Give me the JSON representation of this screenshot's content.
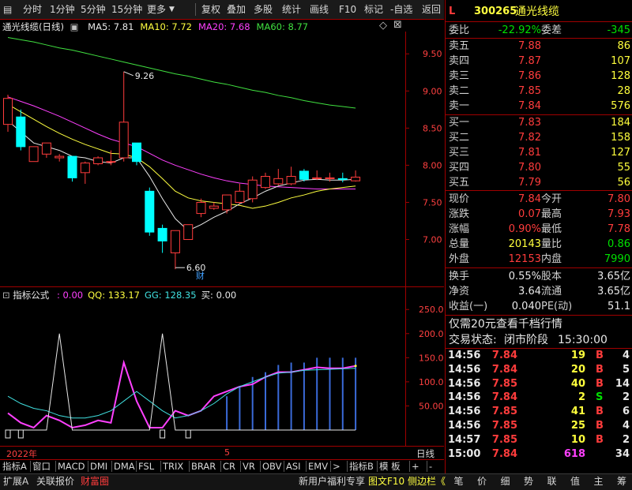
{
  "toolbar": {
    "left": [
      "分时",
      "1分钟",
      "5分钟",
      "15分钟",
      "更多"
    ],
    "right": [
      "复权",
      "叠加",
      "多股",
      "统计",
      "画线",
      "F10",
      "标记",
      "-自选",
      "返回"
    ]
  },
  "stock": {
    "flag": "L",
    "code": "300265",
    "name": "通光线缆"
  },
  "kline": {
    "title": "通光线缆(日线)",
    "ma": [
      {
        "label": "MA5: 7.81",
        "color": "#e8e8e8"
      },
      {
        "label": "MA10: 7.72",
        "color": "#ffff40"
      },
      {
        "label": "MA20: 7.68",
        "color": "#ff40ff"
      },
      {
        "label": "MA60: 8.77",
        "color": "#40e040"
      }
    ],
    "yticks": [
      "9.50",
      "9.00",
      "8.50",
      "8.00",
      "7.50",
      "7.00"
    ],
    "high_label": "9.26",
    "low_label": "6.60",
    "fin_marker": "财"
  },
  "indicator": {
    "title": "指标公式",
    "values": [
      {
        "label": ": 0.00",
        "color": "#ff40ff"
      },
      {
        "label": "QQ: 133.17",
        "color": "#ffff40"
      },
      {
        "label": "GG: 128.35",
        "color": "#40e0e0"
      },
      {
        "label": "买: 0.00",
        "color": "#e8e8e8"
      }
    ],
    "yticks": [
      "250.0",
      "200.0",
      "150.0",
      "100.0",
      "50.00"
    ]
  },
  "timeaxis": {
    "year": "2022年",
    "month": "5",
    "period": "日线"
  },
  "tabs": [
    "指标A",
    "窗口",
    "MACD",
    "DMI",
    "DMA",
    "FSL",
    "TRIX",
    "BRAR",
    "CR",
    "VR",
    "OBV",
    "ASI",
    "EMV",
    ">",
    "指标B",
    "模 板",
    "+",
    "-"
  ],
  "footer": {
    "left": [
      "扩展A",
      "关联报价",
      "财富圈"
    ],
    "mid": [
      "新用户福利专享",
      "图文F10",
      "侧边栏《"
    ],
    "right": [
      "笔",
      "价",
      "细",
      "势",
      "联",
      "值",
      "主",
      "筹"
    ]
  },
  "quote": {
    "weibi_label": "委比",
    "weibi": "-22.92%",
    "weicha_label": "委差",
    "weicha": "-345",
    "asks": [
      {
        "label": "卖五",
        "price": "7.88",
        "vol": "86"
      },
      {
        "label": "卖四",
        "price": "7.87",
        "vol": "107"
      },
      {
        "label": "卖三",
        "price": "7.86",
        "vol": "128"
      },
      {
        "label": "卖二",
        "price": "7.85",
        "vol": "28"
      },
      {
        "label": "卖一",
        "price": "7.84",
        "vol": "576"
      }
    ],
    "bids": [
      {
        "label": "买一",
        "price": "7.83",
        "vol": "184"
      },
      {
        "label": "买二",
        "price": "7.82",
        "vol": "158"
      },
      {
        "label": "买三",
        "price": "7.81",
        "vol": "127"
      },
      {
        "label": "买四",
        "price": "7.80",
        "vol": "55"
      },
      {
        "label": "买五",
        "price": "7.79",
        "vol": "56"
      }
    ],
    "stats": [
      {
        "l1": "现价",
        "v1": "7.84",
        "c1": "red",
        "l2": "今开",
        "v2": "7.80",
        "c2": "red"
      },
      {
        "l1": "涨跌",
        "v1": "0.07",
        "c1": "red",
        "l2": "最高",
        "v2": "7.93",
        "c2": "red"
      },
      {
        "l1": "涨幅",
        "v1": "0.90%",
        "c1": "red",
        "l2": "最低",
        "v2": "7.78",
        "c2": "red"
      },
      {
        "l1": "总量",
        "v1": "20143",
        "c1": "yel",
        "l2": "量比",
        "v2": "0.86",
        "c2": "grn"
      },
      {
        "l1": "外盘",
        "v1": "12153",
        "c1": "red",
        "l2": "内盘",
        "v2": "7990",
        "c2": "grn"
      }
    ],
    "stats2": [
      {
        "l1": "换手",
        "v1": "0.55%",
        "l2": "股本",
        "v2": "3.65亿"
      },
      {
        "l1": "净资",
        "v1": "3.64",
        "l2": "流通",
        "v2": "3.65亿"
      },
      {
        "l1": "收益(一)",
        "v1": "0.040",
        "l2": "PE(动)",
        "v2": "51.1"
      }
    ],
    "promo": "仅需20元查看千档行情",
    "status_label": "交易状态:",
    "status": "闭市阶段",
    "status_time": "15:30:00",
    "ticks": [
      {
        "time": "14:56",
        "price": "7.84",
        "vol": "19",
        "bs": "B",
        "n": "4",
        "vc": "yel",
        "bc": "red"
      },
      {
        "time": "14:56",
        "price": "7.84",
        "vol": "20",
        "bs": "B",
        "n": "5",
        "vc": "yel",
        "bc": "red"
      },
      {
        "time": "14:56",
        "price": "7.85",
        "vol": "40",
        "bs": "B",
        "n": "14",
        "vc": "yel",
        "bc": "red"
      },
      {
        "time": "14:56",
        "price": "7.84",
        "vol": "2",
        "bs": "S",
        "n": "2",
        "vc": "yel",
        "bc": "grn"
      },
      {
        "time": "14:56",
        "price": "7.85",
        "vol": "41",
        "bs": "B",
        "n": "6",
        "vc": "yel",
        "bc": "red"
      },
      {
        "time": "14:56",
        "price": "7.85",
        "vol": "25",
        "bs": "B",
        "n": "4",
        "vc": "yel",
        "bc": "red"
      },
      {
        "time": "14:57",
        "price": "7.85",
        "vol": "10",
        "bs": "B",
        "n": "2",
        "vc": "yel",
        "bc": "red"
      },
      {
        "time": "15:00",
        "price": "7.84",
        "vol": "618",
        "bs": "",
        "n": "34",
        "vc": "mag",
        "bc": "red"
      }
    ]
  },
  "chart_data": [
    {
      "type": "candlestick",
      "title": "通光线缆(日线)",
      "ylim": [
        6.4,
        9.8
      ],
      "candles": [
        {
          "o": 8.55,
          "c": 8.9,
          "h": 8.95,
          "l": 8.45
        },
        {
          "o": 8.65,
          "c": 8.25,
          "h": 8.75,
          "l": 8.2
        },
        {
          "o": 8.05,
          "c": 8.25,
          "h": 8.25,
          "l": 8.05
        },
        {
          "o": 8.15,
          "c": 8.3,
          "h": 8.3,
          "l": 8.1
        },
        {
          "o": 8.1,
          "c": 8.12,
          "h": 8.15,
          "l": 8.05
        },
        {
          "o": 8.12,
          "c": 7.83,
          "h": 8.12,
          "l": 7.78
        },
        {
          "o": 7.9,
          "c": 8.03,
          "h": 8.05,
          "l": 7.75
        },
        {
          "o": 8.02,
          "c": 8.1,
          "h": 8.12,
          "l": 8.0
        },
        {
          "o": 8.05,
          "c": 8.05,
          "h": 8.2,
          "l": 8.0
        },
        {
          "o": 8.1,
          "c": 8.58,
          "h": 9.26,
          "l": 8.05
        },
        {
          "o": 8.3,
          "c": 8.05,
          "h": 8.3,
          "l": 8.0
        },
        {
          "o": 7.65,
          "c": 7.1,
          "h": 7.7,
          "l": 7.05
        },
        {
          "o": 7.15,
          "c": 6.98,
          "h": 7.2,
          "l": 6.82
        },
        {
          "o": 6.82,
          "c": 7.12,
          "h": 7.12,
          "l": 6.6
        },
        {
          "o": 7.0,
          "c": 7.2,
          "h": 7.2,
          "l": 7.0
        },
        {
          "o": 7.35,
          "c": 7.5,
          "h": 7.55,
          "l": 7.3
        },
        {
          "o": 7.42,
          "c": 7.45,
          "h": 7.5,
          "l": 7.4
        },
        {
          "o": 7.4,
          "c": 7.6,
          "h": 7.6,
          "l": 7.35
        },
        {
          "o": 7.5,
          "c": 7.65,
          "h": 7.75,
          "l": 7.48
        },
        {
          "o": 7.55,
          "c": 7.8,
          "h": 7.85,
          "l": 7.5
        },
        {
          "o": 7.7,
          "c": 7.85,
          "h": 7.9,
          "l": 7.68
        },
        {
          "o": 7.75,
          "c": 7.82,
          "h": 7.95,
          "l": 7.73
        },
        {
          "o": 7.75,
          "c": 7.85,
          "h": 7.98,
          "l": 7.73
        },
        {
          "o": 7.92,
          "c": 7.81,
          "h": 7.95,
          "l": 7.78
        },
        {
          "o": 7.82,
          "c": 7.83,
          "h": 7.93,
          "l": 7.8
        },
        {
          "o": 7.83,
          "c": 7.83,
          "h": 7.9,
          "l": 7.78
        },
        {
          "o": 7.82,
          "c": 7.81,
          "h": 7.9,
          "l": 7.77
        },
        {
          "o": 7.79,
          "c": 7.84,
          "h": 7.93,
          "l": 7.78
        }
      ],
      "ma5": [
        8.6,
        8.45,
        8.3,
        8.25,
        8.2,
        8.12,
        8.1,
        8.05,
        8.03,
        8.1,
        8.1,
        7.85,
        7.55,
        7.28,
        7.12,
        7.2,
        7.3,
        7.38,
        7.48,
        7.56,
        7.65,
        7.72,
        7.76,
        7.8,
        7.81,
        7.8,
        7.8,
        7.81
      ],
      "ma10": [
        8.82,
        8.72,
        8.62,
        8.52,
        8.43,
        8.35,
        8.28,
        8.22,
        8.16,
        8.15,
        8.1,
        7.98,
        7.82,
        7.65,
        7.56,
        7.52,
        7.5,
        7.48,
        7.46,
        7.42,
        7.45,
        7.5,
        7.56,
        7.6,
        7.65,
        7.68,
        7.7,
        7.72
      ],
      "ma20": [
        8.92,
        8.86,
        8.8,
        8.73,
        8.66,
        8.58,
        8.5,
        8.42,
        8.35,
        8.3,
        8.25,
        8.16,
        8.07,
        8.0,
        7.94,
        7.88,
        7.83,
        7.79,
        7.76,
        7.74,
        7.72,
        7.71,
        7.7,
        7.69,
        7.68,
        7.68,
        7.68,
        7.68
      ],
      "ma60": [
        9.72,
        9.69,
        9.66,
        9.62,
        9.58,
        9.55,
        9.51,
        9.47,
        9.43,
        9.39,
        9.35,
        9.31,
        9.27,
        9.23,
        9.2,
        9.16,
        9.12,
        9.09,
        9.05,
        9.01,
        8.98,
        8.94,
        8.91,
        8.87,
        8.84,
        8.81,
        8.79,
        8.77
      ]
    },
    {
      "type": "line",
      "title": "指标公式",
      "ylim": [
        0,
        270
      ],
      "series": [
        {
          "name": "",
          "color": "#ff40ff",
          "values": [
            35,
            15,
            5,
            30,
            20,
            5,
            10,
            20,
            15,
            140,
            60,
            5,
            5,
            40,
            30,
            40,
            70,
            80,
            90,
            95,
            110,
            120,
            120,
            125,
            130,
            128,
            128,
            133
          ]
        },
        {
          "name": "QQ",
          "color": "#ffff40",
          "values": [
            null,
            null,
            null,
            null,
            null,
            null,
            null,
            null,
            null,
            null,
            null,
            null,
            null,
            null,
            null,
            null,
            null,
            null,
            null,
            null,
            null,
            null,
            null,
            null,
            null,
            null,
            null,
            133
          ]
        },
        {
          "name": "GG",
          "color": "#40e0e0",
          "values": [
            70,
            55,
            45,
            40,
            30,
            25,
            25,
            30,
            40,
            60,
            80,
            60,
            40,
            25,
            30,
            40,
            55,
            75,
            90,
            100,
            110,
            118,
            120,
            124,
            125,
            126,
            127,
            128
          ]
        },
        {
          "name": "买",
          "color": "#e8e8e8",
          "values": [
            0,
            0,
            0,
            0,
            200,
            0,
            0,
            0,
            0,
            0,
            0,
            0,
            200,
            0,
            0,
            0,
            0,
            0,
            0,
            0,
            0,
            0,
            0,
            0,
            0,
            0,
            0,
            0
          ]
        }
      ],
      "bars": [
        0,
        0,
        0,
        0,
        0,
        0,
        0,
        0,
        0,
        0,
        0,
        0,
        0,
        0,
        0,
        0,
        0,
        70,
        90,
        110,
        120,
        135,
        140,
        140,
        150,
        150,
        150,
        150
      ]
    }
  ]
}
